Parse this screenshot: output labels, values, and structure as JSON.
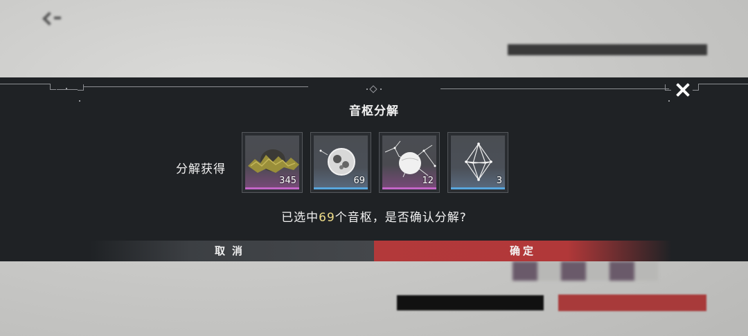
{
  "dialog": {
    "title": "音枢分解",
    "reward_label": "分解获得",
    "close_icon": "close-icon",
    "rewards": [
      {
        "quantity": "345",
        "rarity": "purple",
        "icon": "crystal-ore-icon"
      },
      {
        "quantity": "69",
        "rarity": "blue",
        "icon": "sphere-fragment-icon"
      },
      {
        "quantity": "12",
        "rarity": "purple",
        "icon": "orb-network-icon"
      },
      {
        "quantity": "3",
        "rarity": "blue",
        "icon": "wireframe-crystal-icon"
      }
    ],
    "question": {
      "prefix": "已选中",
      "count": "69",
      "suffix": "个音枢，是否确认分解?"
    },
    "cancel_label": "取消",
    "confirm_label": "确定"
  },
  "colors": {
    "dialog_bg": "#1f2225",
    "confirm": "#b3393a",
    "highlight": "#f0de8a",
    "rarity_purple": "#c466c8",
    "rarity_blue": "#58a7df"
  }
}
